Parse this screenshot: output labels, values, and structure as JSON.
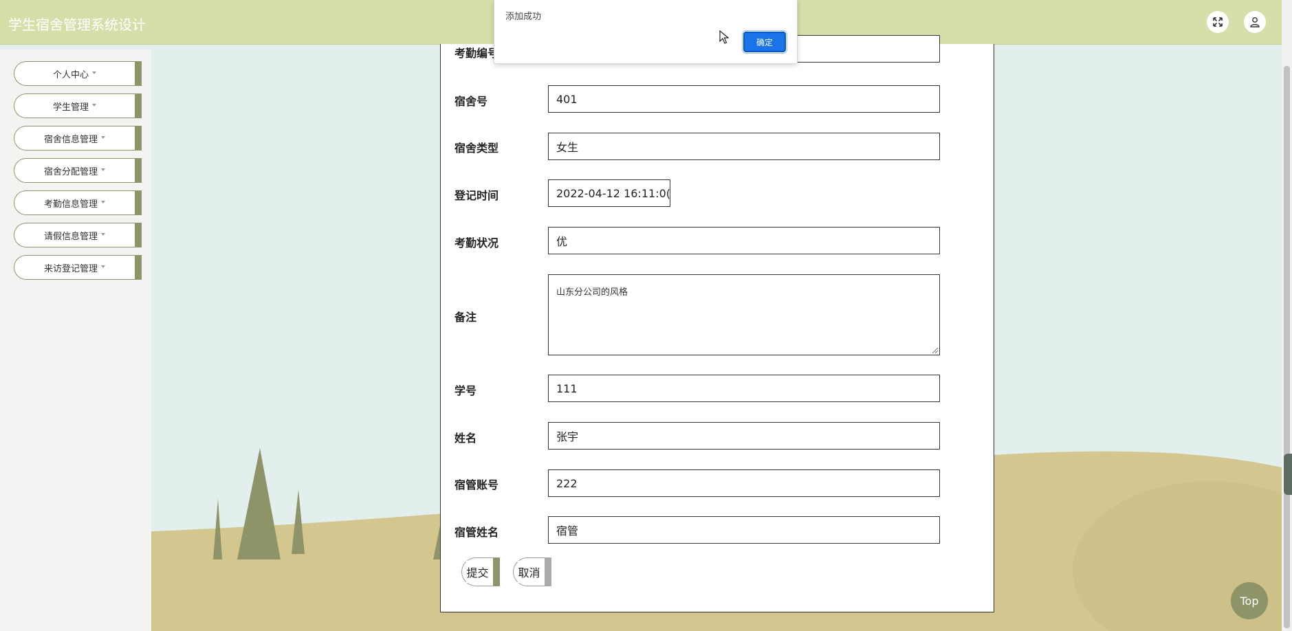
{
  "header": {
    "title": "学生宿舍管理系统设计",
    "fullscreen_icon": "expand-icon",
    "user_icon": "user-icon"
  },
  "sidebar": {
    "items": [
      {
        "label": "个人中心"
      },
      {
        "label": "学生管理"
      },
      {
        "label": "宿舍信息管理"
      },
      {
        "label": "宿舍分配管理"
      },
      {
        "label": "考勤信息管理"
      },
      {
        "label": "请假信息管理"
      },
      {
        "label": "来访登记管理"
      }
    ]
  },
  "form": {
    "fields": [
      {
        "label": "考勤编号",
        "value": ""
      },
      {
        "label": "宿舍号",
        "value": "401"
      },
      {
        "label": "宿舍类型",
        "value": "女生"
      },
      {
        "label": "登记时间",
        "value": "2022-04-12 16:11:0("
      },
      {
        "label": "考勤状况",
        "value": "优"
      },
      {
        "label": "备注",
        "value": "山东分公司的风格"
      },
      {
        "label": "学号",
        "value": "111"
      },
      {
        "label": "姓名",
        "value": "张宇"
      },
      {
        "label": "宿管账号",
        "value": "222"
      },
      {
        "label": "宿管姓名",
        "value": "宿管"
      }
    ],
    "submit_label": "提交",
    "cancel_label": "取消"
  },
  "dialog": {
    "message": "添加成功",
    "ok_label": "确定"
  },
  "top_button": {
    "label": "Top"
  },
  "colors": {
    "header_bg": "#d5dfa9",
    "accent": "#8e9368",
    "sky": "#e2efec",
    "ground": "#d3c78f",
    "dialog_button": "#1a73e8"
  }
}
